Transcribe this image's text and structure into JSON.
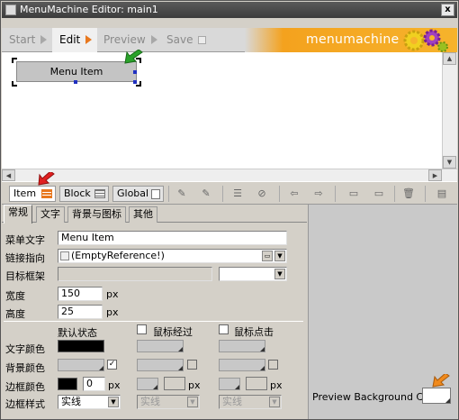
{
  "window": {
    "title": "MenuMachine Editor: main1",
    "close_label": "x"
  },
  "steps": [
    {
      "label": "Start"
    },
    {
      "label": "Edit"
    },
    {
      "label": "Preview"
    },
    {
      "label": "Save"
    }
  ],
  "brand": {
    "name": "menumachine"
  },
  "canvas": {
    "menu_item_label": "Menu Item"
  },
  "toolbar": {
    "item_label": "Item",
    "block_label": "Block",
    "global_label": "Global"
  },
  "tabs": [
    "常规",
    "文字",
    "背景与图标",
    "其他"
  ],
  "form": {
    "menu_text_label": "菜单文字",
    "menu_text_value": "Menu Item",
    "link_label": "链接指向",
    "link_value": "(EmptyReference!)",
    "target_label": "目标框架",
    "target_value": "",
    "width_label": "宽度",
    "width_value": "150",
    "width_unit": "px",
    "height_label": "高度",
    "height_value": "25",
    "height_unit": "px"
  },
  "states": {
    "default_label": "默认状态",
    "hover_label": "鼠标经过",
    "click_label": "鼠标点击"
  },
  "style_rows": {
    "text_color_label": "文字颜色",
    "bg_color_label": "背景颜色",
    "border_color_label": "边框颜色",
    "border_style_label": "边框样式",
    "border_width_value": "0",
    "px_unit": "px",
    "border_style_value": "实线",
    "border_style_hover": "实线",
    "border_style_click": "实线"
  },
  "preview": {
    "bg_label": "Preview Background Color"
  },
  "colors": {
    "accent_orange": "#e8781e",
    "annotation_green": "#2aa22a",
    "annotation_red": "#e02020",
    "text_color_swatch": "#000000",
    "border_color_swatch": "#000000"
  }
}
